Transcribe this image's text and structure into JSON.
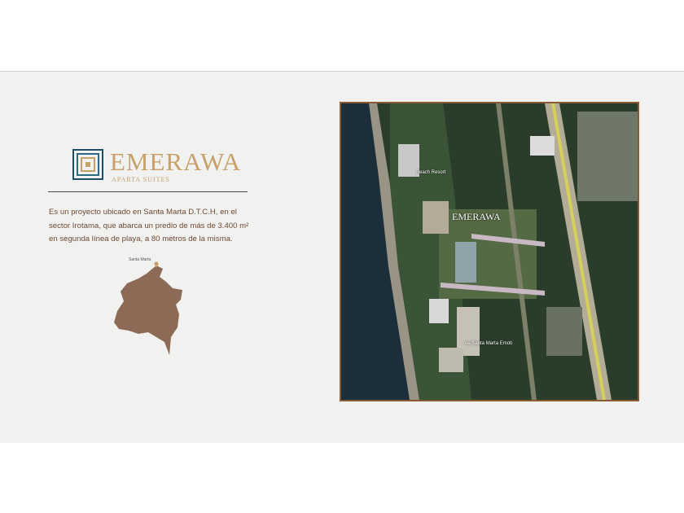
{
  "brand": {
    "name": "EMERAWA",
    "tagline": "APARTA SUITES",
    "accent_color": "#c7a06a"
  },
  "description": "Es un proyecto ubicado en Santa Marta D.T.C.H, en el sector Irotama, que abarca un predio de más de 3.400 m² en segunda línea de playa, a 80 metros de la misma.",
  "country_map": {
    "label": "Santa Marta",
    "color": "#8c6a55",
    "icon": "location-pin-icon"
  },
  "aerial_map": {
    "border_color": "#8a5a33",
    "labels": {
      "beach_resort": "Beach Resort",
      "santa_marta": "de Santa Marta Emoti",
      "overlay_brand": "EMERAWA"
    }
  }
}
